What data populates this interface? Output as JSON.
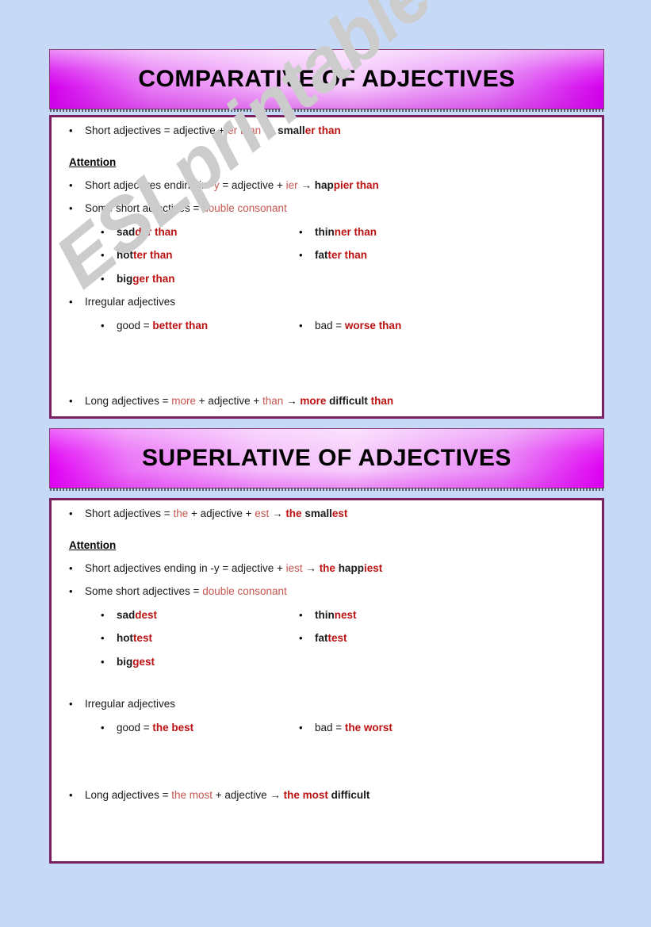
{
  "watermark": "ESLprintables.com",
  "colors": {
    "page_background": "#c6daf8",
    "panel_border": "#7c1f5e",
    "banner_magenta": "#d400ee",
    "banner_pink": "#f6c9fc",
    "text_red_light": "#c4564f",
    "text_red_bold": "#bb1111",
    "text_black": "#1a1a1a",
    "watermark_gray": "#cccccc"
  },
  "sections": [
    {
      "id": "comparative",
      "title": "COMPARATIVE OF ADJECTIVES",
      "attention_label": "Attention",
      "rule_short": {
        "parts": [
          {
            "t": "Short adjectives = adjective + ",
            "s": "blk"
          },
          {
            "t": "er than",
            "s": "red"
          },
          {
            "t": " → ",
            "s": "blk"
          },
          {
            "t": "small",
            "s": "bblk"
          },
          {
            "t": "er than",
            "s": "bred"
          }
        ]
      },
      "rule_y": {
        "parts": [
          {
            "t": "Short adjectives ending in ",
            "s": "blk"
          },
          {
            "t": "-y",
            "s": "red"
          },
          {
            "t": " = adjective + ",
            "s": "blk"
          },
          {
            "t": "ier",
            "s": "red"
          },
          {
            "t": " → ",
            "s": "blk"
          },
          {
            "t": "hap",
            "s": "bblk"
          },
          {
            "t": "pier than",
            "s": "bred"
          }
        ]
      },
      "rule_double": {
        "parts": [
          {
            "t": "Some short adjectives = ",
            "s": "blk"
          },
          {
            "t": "double consonant",
            "s": "red"
          }
        ]
      },
      "double_examples": [
        [
          {
            "parts": [
              {
                "t": "sad",
                "s": "bblk"
              },
              {
                "t": "der than",
                "s": "bred"
              }
            ]
          },
          {
            "parts": [
              {
                "t": "thin",
                "s": "bblk"
              },
              {
                "t": "ner than",
                "s": "bred"
              }
            ]
          }
        ],
        [
          {
            "parts": [
              {
                "t": "hot",
                "s": "bblk"
              },
              {
                "t": "ter than",
                "s": "bred"
              }
            ]
          },
          {
            "parts": [
              {
                "t": "fat",
                "s": "bblk"
              },
              {
                "t": "ter than",
                "s": "bred"
              }
            ]
          }
        ],
        [
          {
            "parts": [
              {
                "t": "big",
                "s": "bblk"
              },
              {
                "t": "ger than",
                "s": "bred"
              }
            ]
          },
          null
        ]
      ],
      "irregular_label": {
        "parts": [
          {
            "t": "Irregular adjectives",
            "s": "blk"
          }
        ]
      },
      "irregular_examples": [
        [
          {
            "parts": [
              {
                "t": "good = ",
                "s": "blk"
              },
              {
                "t": "better than",
                "s": "bred"
              }
            ]
          },
          {
            "parts": [
              {
                "t": "bad = ",
                "s": "blk"
              },
              {
                "t": "worse than",
                "s": "bred"
              }
            ]
          }
        ]
      ],
      "rule_long": {
        "parts": [
          {
            "t": "Long adjectives = ",
            "s": "blk"
          },
          {
            "t": "more",
            "s": "red"
          },
          {
            "t": " + adjective + ",
            "s": "blk"
          },
          {
            "t": "than",
            "s": "red"
          },
          {
            "t": " → ",
            "s": "blk"
          },
          {
            "t": "more",
            "s": "bred"
          },
          {
            "t": " difficult ",
            "s": "bblk"
          },
          {
            "t": "than",
            "s": "bred"
          }
        ]
      }
    },
    {
      "id": "superlative",
      "title": "SUPERLATIVE OF ADJECTIVES",
      "attention_label": "Attention",
      "rule_short": {
        "parts": [
          {
            "t": "Short adjectives = ",
            "s": "blk"
          },
          {
            "t": "the",
            "s": "red"
          },
          {
            "t": " + adjective + ",
            "s": "blk"
          },
          {
            "t": "est",
            "s": "red"
          },
          {
            "t": "  → ",
            "s": "blk"
          },
          {
            "t": "the",
            "s": "bred"
          },
          {
            "t": " small",
            "s": "bblk"
          },
          {
            "t": "est",
            "s": "bred"
          }
        ]
      },
      "rule_y": {
        "parts": [
          {
            "t": "Short adjectives ending in -y = adjective + ",
            "s": "blk"
          },
          {
            "t": "iest",
            "s": "red"
          },
          {
            "t": " → ",
            "s": "blk"
          },
          {
            "t": "the",
            "s": "bred"
          },
          {
            "t": " happ",
            "s": "bblk"
          },
          {
            "t": "iest",
            "s": "bred"
          }
        ]
      },
      "rule_double": {
        "parts": [
          {
            "t": "Some short adjectives = ",
            "s": "blk"
          },
          {
            "t": "double consonant",
            "s": "red"
          }
        ]
      },
      "double_examples": [
        [
          {
            "parts": [
              {
                "t": "sad",
                "s": "bblk"
              },
              {
                "t": "dest",
                "s": "bred"
              }
            ]
          },
          {
            "parts": [
              {
                "t": "thin",
                "s": "bblk"
              },
              {
                "t": "nest",
                "s": "bred"
              }
            ]
          }
        ],
        [
          {
            "parts": [
              {
                "t": "hot",
                "s": "bblk"
              },
              {
                "t": "test",
                "s": "bred"
              }
            ]
          },
          {
            "parts": [
              {
                "t": "fat",
                "s": "bblk"
              },
              {
                "t": "test",
                "s": "bred"
              }
            ]
          }
        ],
        [
          {
            "parts": [
              {
                "t": "big",
                "s": "bblk"
              },
              {
                "t": "gest",
                "s": "bred"
              }
            ]
          },
          null
        ]
      ],
      "irregular_label": {
        "parts": [
          {
            "t": "Irregular adjectives",
            "s": "blk"
          }
        ]
      },
      "irregular_examples": [
        [
          {
            "parts": [
              {
                "t": "good = ",
                "s": "blk"
              },
              {
                "t": "the best",
                "s": "bred"
              }
            ]
          },
          {
            "parts": [
              {
                "t": "bad = ",
                "s": "blk"
              },
              {
                "t": "the worst",
                "s": "bred"
              }
            ]
          }
        ]
      ],
      "rule_long": {
        "parts": [
          {
            "t": "Long adjectives =  ",
            "s": "blk"
          },
          {
            "t": "the most",
            "s": "red"
          },
          {
            "t": "  + adjective  → ",
            "s": "blk"
          },
          {
            "t": "the most",
            "s": "bred"
          },
          {
            "t": " difficult",
            "s": "bblk"
          }
        ]
      }
    }
  ]
}
